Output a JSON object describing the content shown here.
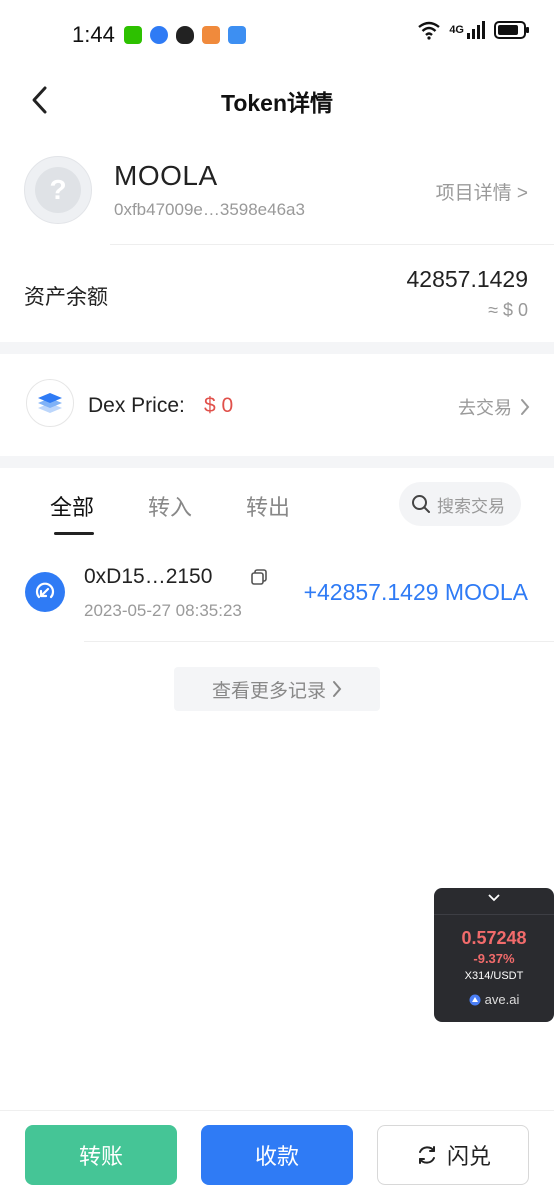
{
  "status_bar": {
    "time": "1:44",
    "network": "4G"
  },
  "header": {
    "title": "Token详情"
  },
  "token": {
    "name": "MOOLA",
    "address": "0xfb47009e…3598e46a3",
    "project_link": "项目详情 >"
  },
  "balance": {
    "label": "资产余额",
    "amount": "42857.1429",
    "fiat": "≈ $  0"
  },
  "dex": {
    "label": "Dex Price:",
    "value": "$ 0",
    "trade_link": "去交易"
  },
  "tabs": [
    {
      "label": "全部",
      "active": true
    },
    {
      "label": "转入",
      "active": false
    },
    {
      "label": "转出",
      "active": false
    }
  ],
  "search": {
    "placeholder": "搜索交易"
  },
  "transactions": [
    {
      "address": "0xD15…2150",
      "time": "2023-05-27 08:35:23",
      "amount": "+42857.1429 MOOLA"
    }
  ],
  "more_records": "查看更多记录",
  "float_widget": {
    "price": "0.57248",
    "change": "-9.37%",
    "pair": "X314/USDT",
    "brand": "ave.ai"
  },
  "bottom": {
    "transfer": "转账",
    "receive": "收款",
    "swap": "闪兑"
  },
  "colors": {
    "accent_blue": "#2f7bf5",
    "green": "#45c596",
    "red": "#e0504a"
  }
}
